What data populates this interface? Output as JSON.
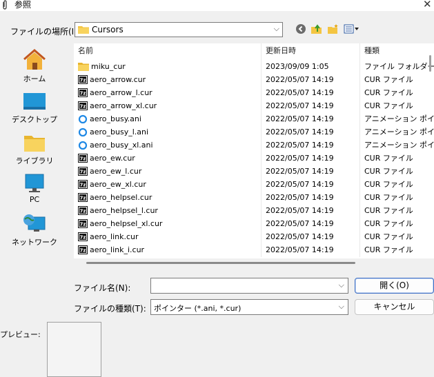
{
  "window": {
    "title": "参照"
  },
  "location": {
    "label": "ファイルの場所(I):",
    "value": "Cursors"
  },
  "toolbar": {
    "icons": [
      "back-icon",
      "up-folder-icon",
      "new-folder-icon",
      "view-menu-icon"
    ]
  },
  "places": [
    {
      "label": "ホーム",
      "icon": "home-icon"
    },
    {
      "label": "デスクトップ",
      "icon": "desktop-icon"
    },
    {
      "label": "ライブラリ",
      "icon": "library-icon"
    },
    {
      "label": "PC",
      "icon": "pc-icon"
    },
    {
      "label": "ネットワーク",
      "icon": "network-icon"
    }
  ],
  "columns": {
    "name": "名前",
    "date": "更新日時",
    "type": "種類"
  },
  "files": [
    {
      "name": "miku_cur",
      "date": "2023/09/09 1:05",
      "type": "ファイル フォルダー",
      "icon": "folder"
    },
    {
      "name": "aero_arrow.cur",
      "date": "2022/05/07 14:19",
      "type": "CUR ファイル",
      "icon": "cur"
    },
    {
      "name": "aero_arrow_l.cur",
      "date": "2022/05/07 14:19",
      "type": "CUR ファイル",
      "icon": "cur"
    },
    {
      "name": "aero_arrow_xl.cur",
      "date": "2022/05/07 14:19",
      "type": "CUR ファイル",
      "icon": "cur"
    },
    {
      "name": "aero_busy.ani",
      "date": "2022/05/07 14:19",
      "type": "アニメーション ポイン",
      "icon": "ani"
    },
    {
      "name": "aero_busy_l.ani",
      "date": "2022/05/07 14:19",
      "type": "アニメーション ポイン",
      "icon": "ani"
    },
    {
      "name": "aero_busy_xl.ani",
      "date": "2022/05/07 14:19",
      "type": "アニメーション ポイン",
      "icon": "ani"
    },
    {
      "name": "aero_ew.cur",
      "date": "2022/05/07 14:19",
      "type": "CUR ファイル",
      "icon": "cur"
    },
    {
      "name": "aero_ew_l.cur",
      "date": "2022/05/07 14:19",
      "type": "CUR ファイル",
      "icon": "cur"
    },
    {
      "name": "aero_ew_xl.cur",
      "date": "2022/05/07 14:19",
      "type": "CUR ファイル",
      "icon": "cur"
    },
    {
      "name": "aero_helpsel.cur",
      "date": "2022/05/07 14:19",
      "type": "CUR ファイル",
      "icon": "cur"
    },
    {
      "name": "aero_helpsel_l.cur",
      "date": "2022/05/07 14:19",
      "type": "CUR ファイル",
      "icon": "cur"
    },
    {
      "name": "aero_helpsel_xl.cur",
      "date": "2022/05/07 14:19",
      "type": "CUR ファイル",
      "icon": "cur"
    },
    {
      "name": "aero_link.cur",
      "date": "2022/05/07 14:19",
      "type": "CUR ファイル",
      "icon": "cur"
    },
    {
      "name": "aero_link_i.cur",
      "date": "2022/05/07 14:19",
      "type": "CUR ファイル",
      "icon": "cur"
    }
  ],
  "filename": {
    "label": "ファイル名(N):",
    "value": ""
  },
  "filetype": {
    "label": "ファイルの種類(T):",
    "value": "ポインター (*.ani, *.cur)"
  },
  "buttons": {
    "open": "開く(O)",
    "cancel": "キャンセル"
  },
  "preview": {
    "label": "プレビュー:"
  },
  "colors": {
    "folder": "#f4c542",
    "ani_ring": "#1e88e5",
    "accent": "#3d6fc4"
  }
}
